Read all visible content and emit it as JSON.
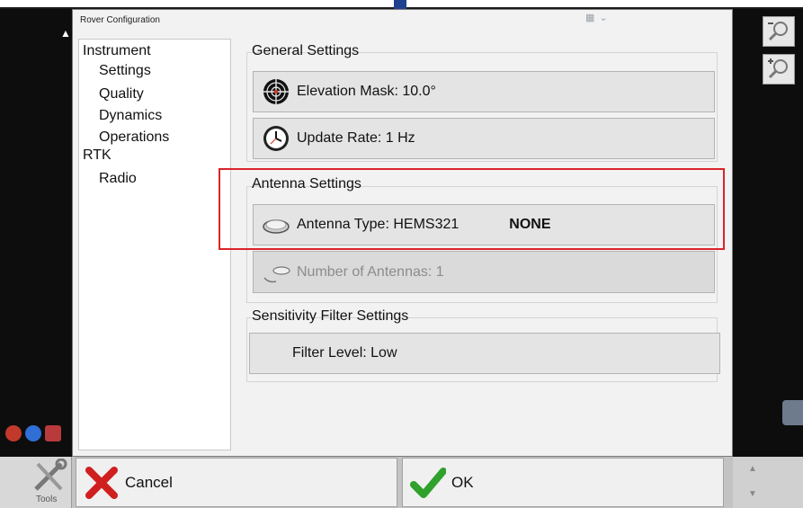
{
  "window": {
    "title": "Rover Configuration"
  },
  "tree": {
    "items": [
      {
        "label": "Instrument",
        "level": 0
      },
      {
        "label": "Settings",
        "level": 1
      },
      {
        "label": "Quality",
        "level": 1
      },
      {
        "label": "Dynamics",
        "level": 1
      },
      {
        "label": "Operations",
        "level": 1
      },
      {
        "label": "RTK",
        "level": 0
      },
      {
        "label": "Radio",
        "level": 1
      }
    ]
  },
  "general": {
    "title": "General Settings",
    "elevation_mask": "Elevation Mask: 10.0°",
    "update_rate": "Update Rate: 1 Hz"
  },
  "antenna": {
    "title": "Antenna Settings",
    "type_label": "Antenna Type: HEMS321",
    "type_value": "NONE",
    "count_label": "Number of Antennas: 1"
  },
  "sensitivity": {
    "title": "Sensitivity Filter Settings",
    "filter_level": "Filter Level: Low"
  },
  "buttons": {
    "cancel": "Cancel",
    "ok": "OK"
  },
  "toolbar": {
    "tools_label": "Tools"
  },
  "colors": {
    "highlight": "#d9242a",
    "dialog_bg": "#f2f2f2",
    "accent_blue": "#1f3f8f"
  },
  "icons": {
    "elevation": "crosshair-icon",
    "update_rate": "clock-icon",
    "antenna": "antenna-disc-icon",
    "cancel": "red-x-icon",
    "ok": "green-check-icon",
    "zoom_out": "zoom-out-icon",
    "zoom_in": "zoom-in-icon"
  }
}
